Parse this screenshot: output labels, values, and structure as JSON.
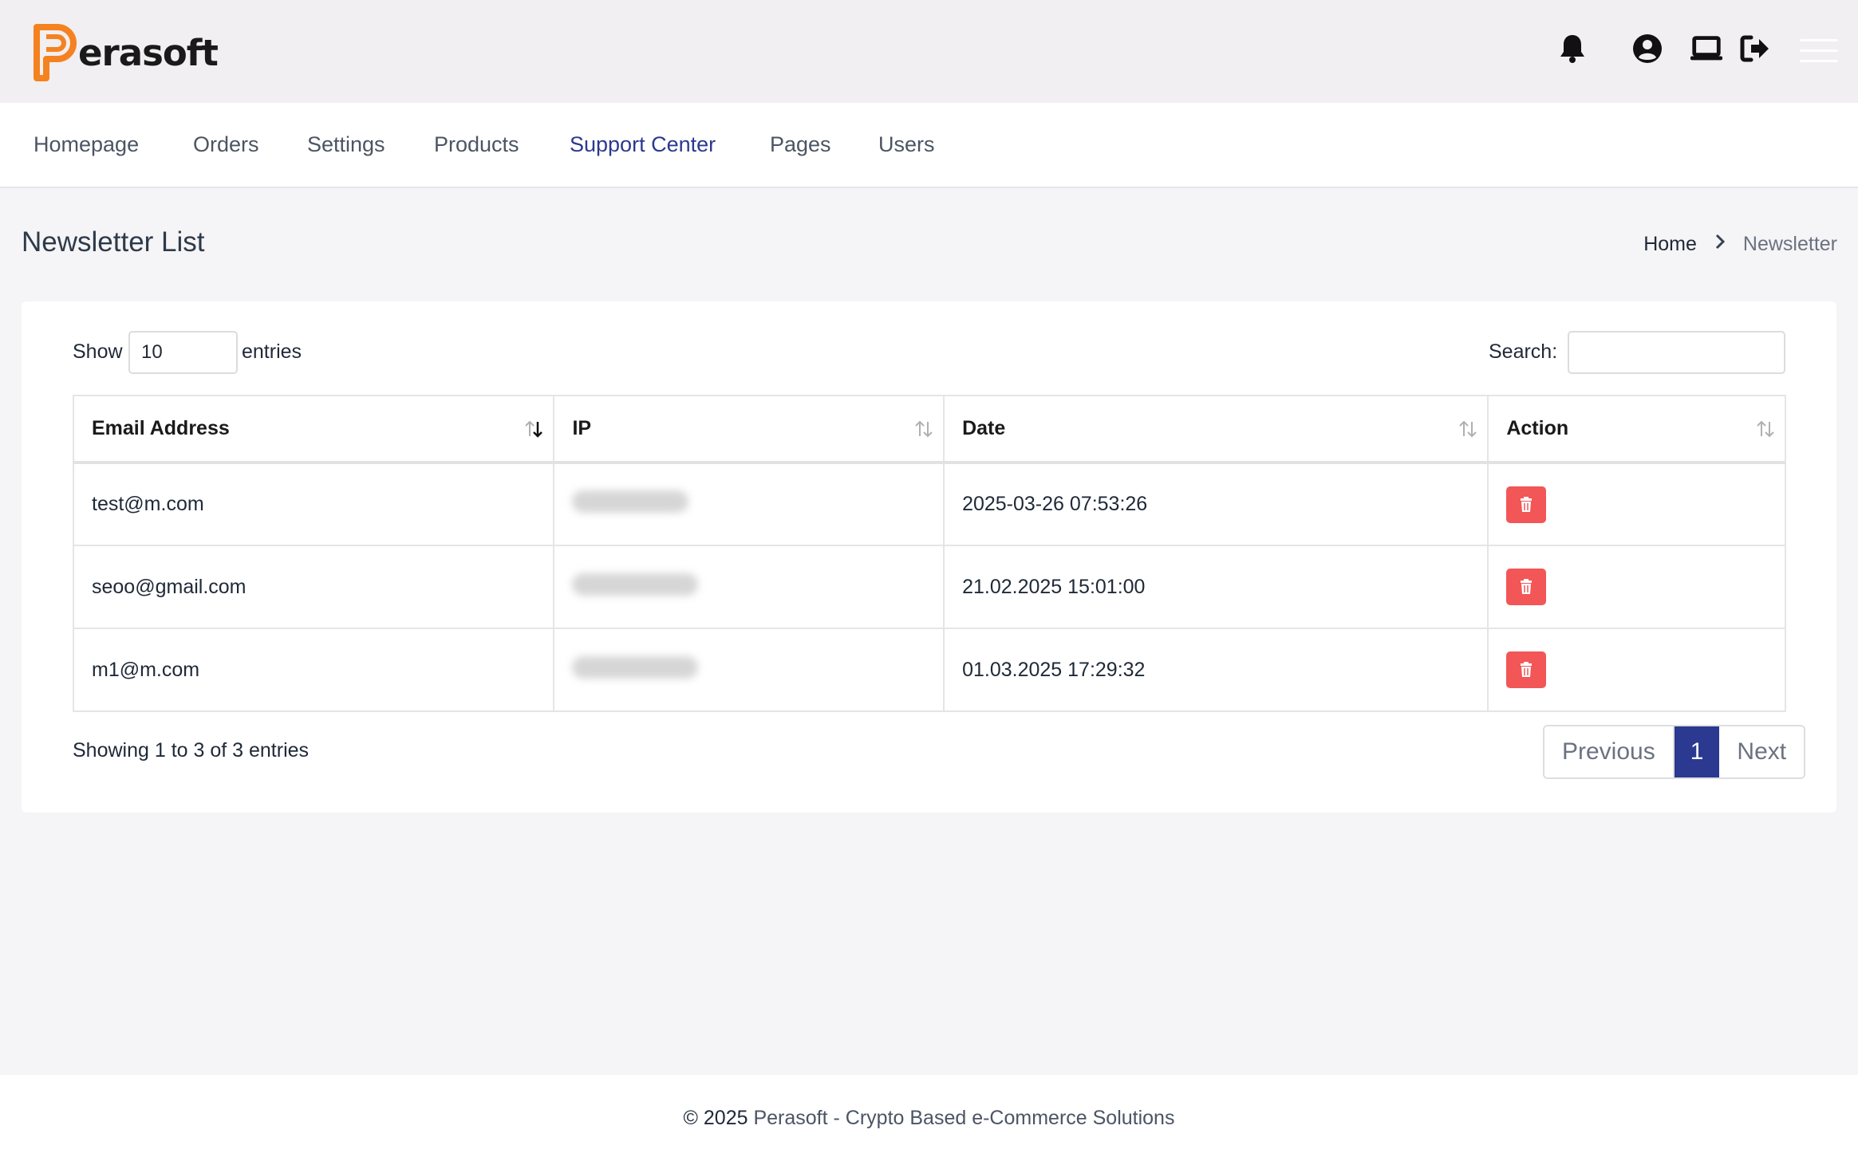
{
  "brand": {
    "name": "erasoft",
    "logo_letter": "P"
  },
  "header_icons": [
    "bell-icon",
    "user-circle-icon",
    "laptop-icon",
    "logout-icon",
    "menu-icon"
  ],
  "nav": {
    "items": [
      {
        "label": "Homepage",
        "active": false
      },
      {
        "label": "Orders",
        "active": false
      },
      {
        "label": "Settings",
        "active": false
      },
      {
        "label": "Products",
        "active": false
      },
      {
        "label": "Support Center",
        "active": true
      },
      {
        "label": "Pages",
        "active": false
      },
      {
        "label": "Users",
        "active": false
      }
    ]
  },
  "page": {
    "title": "Newsletter List",
    "breadcrumb": {
      "home": "Home",
      "current": "Newsletter"
    }
  },
  "table_controls": {
    "show_label": "Show",
    "page_length": "10",
    "entries_label": "entries",
    "search_label": "Search:",
    "search_value": ""
  },
  "table": {
    "columns": [
      "Email Address",
      "IP",
      "Date",
      "Action"
    ],
    "rows": [
      {
        "email": "test@m.com",
        "ip": "hidden",
        "date": "2025-03-26 07:53:26"
      },
      {
        "email": "seoo@gmail.com",
        "ip": "hidden",
        "date": "21.02.2025 15:01:00"
      },
      {
        "email": "m1@m.com",
        "ip": "hidden",
        "date": "01.03.2025 17:29:32"
      }
    ]
  },
  "pagination": {
    "info": "Showing 1 to 3 of 3 entries",
    "previous": "Previous",
    "current": "1",
    "next": "Next"
  },
  "footer": {
    "year": "© 2025",
    "text": "Perasoft - Crypto Based e-Commerce Solutions"
  },
  "colors": {
    "brand_orange": "#f58220",
    "primary": "#2b3990",
    "danger": "#f25656"
  }
}
